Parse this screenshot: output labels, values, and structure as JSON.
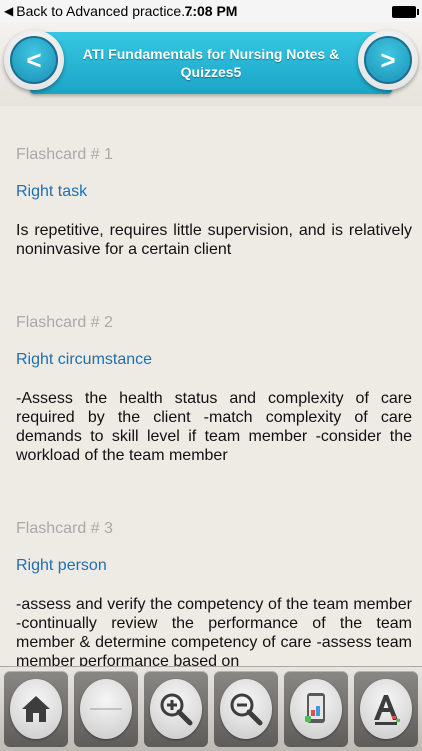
{
  "status_bar": {
    "back_label": "Back to Advanced practice...",
    "time": "7:08 PM"
  },
  "header": {
    "title": "ATI Fundamentals for Nursing Notes & Quizzes5",
    "prev_icon": "chevron-left-icon",
    "next_icon": "chevron-right-icon"
  },
  "flashcards": [
    {
      "number": "Flashcard # 1",
      "term": "Right task",
      "definition": "Is repetitive, requires little supervision, and is relatively noninvasive for a certain client"
    },
    {
      "number": "Flashcard # 2",
      "term": "Right circumstance",
      "definition": "-Assess the health status and complexity of care required by the client -match complexity of care demands to skill level if team member -consider the workload of the team member"
    },
    {
      "number": "Flashcard # 3",
      "term": "Right person",
      "definition": "-assess and verify the competency of the team member -continually review the performance of the team member & determine competency of care -assess team member performance based on"
    }
  ],
  "toolbar": {
    "icons": [
      "home-icon",
      "blank-icon",
      "zoom-in-icon",
      "zoom-out-icon",
      "device-icon",
      "font-icon"
    ]
  }
}
